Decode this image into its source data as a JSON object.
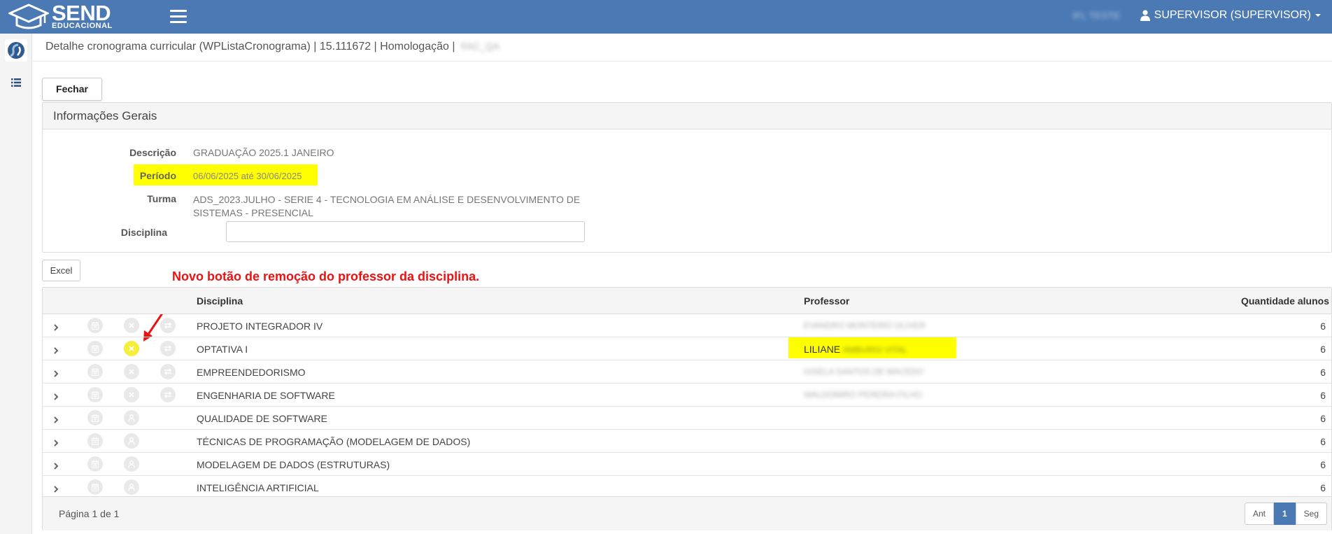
{
  "app": {
    "logo_main": "SEND",
    "logo_sub": "EDUCACIONAL",
    "top_blurred": "IFL TESTE",
    "user_label": "SUPERVISOR (SUPERVISOR)"
  },
  "header": {
    "title": "Detalhe cronograma curricular (WPListaCronograma) | 15.111672 | Homologação |",
    "title_blurred": "FAC_QA"
  },
  "buttons": {
    "close": "Fechar",
    "excel": "Excel"
  },
  "info": {
    "panel_title": "Informações Gerais",
    "descricao_label": "Descrição",
    "descricao_value": "GRADUAÇÃO 2025.1 JANEIRO",
    "periodo_label": "Período",
    "periodo_value": "06/06/2025 até 30/06/2025",
    "turma_label": "Turma",
    "turma_value_line1": "ADS_2023.JULHO - SERIE 4 - TECNOLOGIA EM ANÁLISE E DESENVOLVIMENTO DE",
    "turma_value_line2": "SISTEMAS - PRESENCIAL",
    "disciplina_label": "Disciplina",
    "disciplina_value": ""
  },
  "annotation": "Novo botão de remoção do professor da disciplina.",
  "table": {
    "columns": [
      "Disciplina",
      "Professor",
      "Quantidade alunos"
    ],
    "rows": [
      {
        "disciplina": "PROJETO INTEGRADOR IV",
        "professor": "",
        "professor_blurred": "EVANDRO MONTEIRO OLIVER",
        "qtd": "6",
        "has_professor": true
      },
      {
        "disciplina": "OPTATIVA I",
        "professor": "LILIANE",
        "professor_blurred": "AMBURGI VITAL",
        "qtd": "6",
        "has_professor": true
      },
      {
        "disciplina": "EMPREENDEDORISMO",
        "professor": "",
        "professor_blurred": "GISELA SANTOS DE MACEDO",
        "qtd": "6",
        "has_professor": true
      },
      {
        "disciplina": "ENGENHARIA DE SOFTWARE",
        "professor": "",
        "professor_blurred": "WALDOMIRO PEREIRA FILHO",
        "qtd": "6",
        "has_professor": true
      },
      {
        "disciplina": "QUALIDADE DE SOFTWARE",
        "professor": "",
        "professor_blurred": "",
        "qtd": "6",
        "has_professor": false
      },
      {
        "disciplina": "TÉCNICAS DE PROGRAMAÇÃO (MODELAGEM DE DADOS)",
        "professor": "",
        "professor_blurred": "",
        "qtd": "6",
        "has_professor": false
      },
      {
        "disciplina": "MODELAGEM DE DADOS (ESTRUTURAS)",
        "professor": "",
        "professor_blurred": "",
        "qtd": "6",
        "has_professor": false
      },
      {
        "disciplina": "INTELIGÊNCIA ARTIFICIAL",
        "professor": "",
        "professor_blurred": "",
        "qtd": "6",
        "has_professor": false
      }
    ],
    "footer": "Página 1 de 1",
    "pager": {
      "prev": "Ant",
      "current": "1",
      "next": "Seg"
    }
  },
  "colors": {
    "topbar": "#4a79b4",
    "highlight": "#ffff00",
    "annotation": "#ee1111"
  },
  "icons": [
    "graduation-cap-icon",
    "menu-icon",
    "user-icon",
    "app-logo-icon",
    "list-icon",
    "chevron-right-icon",
    "calendar-icon",
    "remove-icon",
    "swap-icon",
    "add-user-icon"
  ]
}
